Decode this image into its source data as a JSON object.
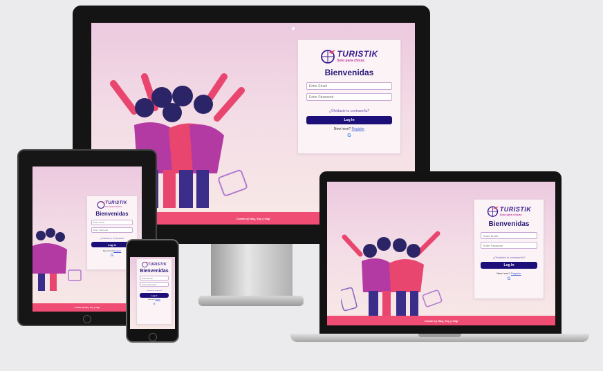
{
  "brand": {
    "name": "TURISTIK",
    "tagline": "Solo para chicas"
  },
  "login": {
    "title": "Bienvenidas",
    "email_placeholder": "Enter Email",
    "password_placeholder": "Enter Password",
    "forgot_label": "¿Olvidaste tu contraseña?",
    "login_button": "Log In",
    "new_here": "New here?",
    "register_link": "Register",
    "google_glyph": "G"
  },
  "footer": {
    "text": "Create by Gaq, Yuy y Gigi"
  },
  "colors": {
    "primary": "#1d0f7a",
    "accent": "#f04d74",
    "brand_purple": "#3a1c8f",
    "brand_pink": "#c13a9d"
  },
  "icons": [
    "globe-plane-logo-icon",
    "google-icon",
    "suitcase-icon",
    "sparkle-icon"
  ]
}
